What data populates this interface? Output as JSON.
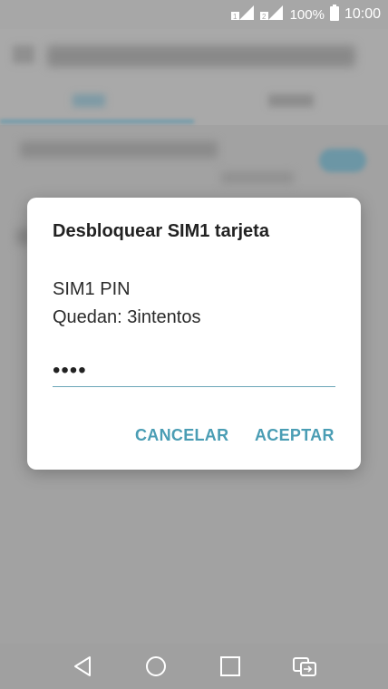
{
  "status_bar": {
    "battery_percent": "100%",
    "time": "10:00",
    "sim1_badge": "1",
    "sim2_badge": "2"
  },
  "dialog": {
    "title": "Desbloquear SIM1 tarjeta",
    "message_line1": "SIM1 PIN",
    "message_line2": "Quedan: 3intentos",
    "pin_value": "••••",
    "cancel_label": "CANCELAR",
    "accept_label": "ACEPTAR"
  },
  "colors": {
    "accent": "#4a9db4",
    "scrim": "#9e9e9e",
    "dialog_bg": "#ffffff"
  },
  "nav_icons": [
    "back-icon",
    "home-icon",
    "recents-icon",
    "dual-sim-switch-icon"
  ]
}
